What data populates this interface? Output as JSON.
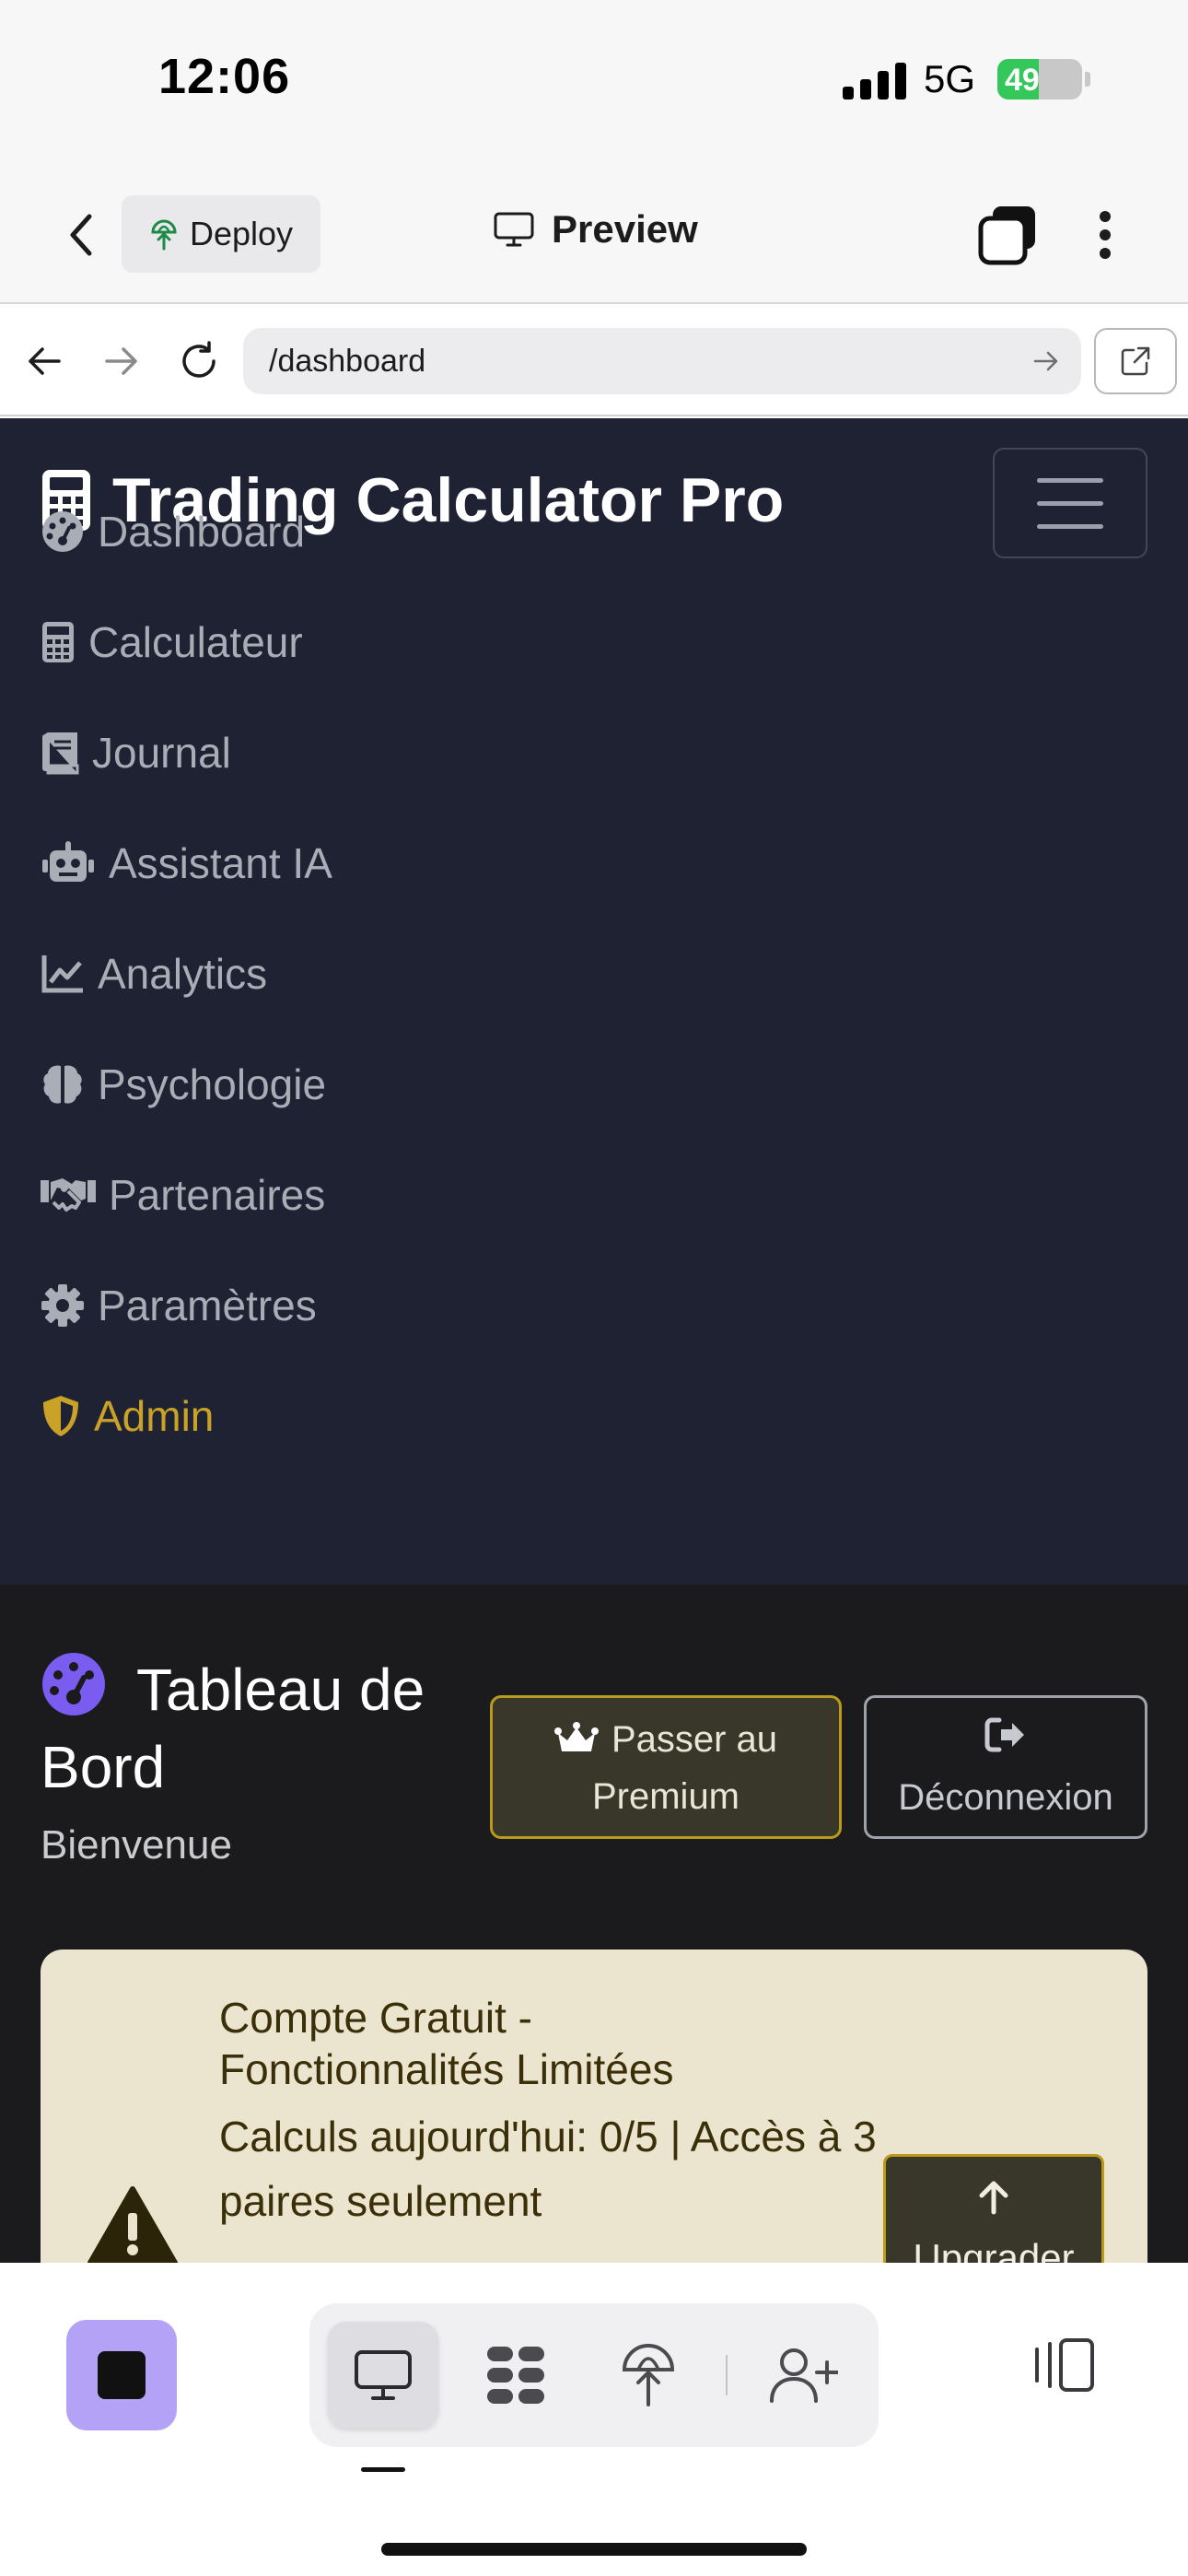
{
  "status_bar": {
    "time": "12:06",
    "network": "5G",
    "battery": "49",
    "battery_level": 0.49
  },
  "app_header": {
    "back_icon": "chevron-left-icon",
    "deploy_label": "Deploy",
    "preview_label": "Preview"
  },
  "browser": {
    "url": "/dashboard"
  },
  "site": {
    "brand": "Trading Calculator Pro",
    "nav": [
      {
        "label": "Dashboard",
        "icon": "gauge-icon"
      },
      {
        "label": "Calculateur",
        "icon": "calculator-icon"
      },
      {
        "label": "Journal",
        "icon": "book-icon"
      },
      {
        "label": "Assistant IA",
        "icon": "robot-icon"
      },
      {
        "label": "Analytics",
        "icon": "chart-line-icon"
      },
      {
        "label": "Psychologie",
        "icon": "brain-icon"
      },
      {
        "label": "Partenaires",
        "icon": "handshake-icon"
      },
      {
        "label": "Paramètres",
        "icon": "gear-icon"
      },
      {
        "label": "Admin",
        "icon": "shield-icon"
      }
    ],
    "admin_color": "#c9a227"
  },
  "dashboard": {
    "title": "Tableau de Bord",
    "subtitle": "Bienvenue",
    "premium_button": "Passer au Premium",
    "logout_button": "Déconnexion"
  },
  "alert": {
    "title": "Compte Gratuit - Fonctionnalités Limitées",
    "text": "Calculs aujourd'hui: 0/5 | Accès à 3 paires seulement",
    "upgrade_button": "Upgrader",
    "color": "#ebe4ce"
  },
  "bottom_bar": {
    "accent": "#b3a2f5"
  }
}
